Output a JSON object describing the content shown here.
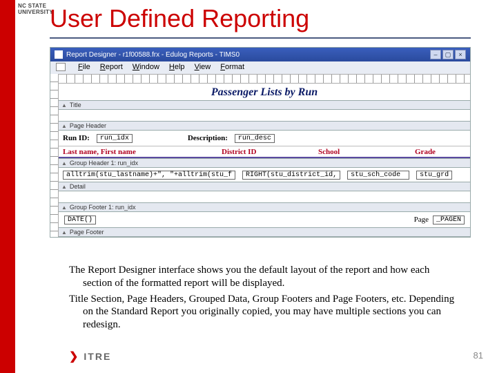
{
  "brand": {
    "line1": "NC STATE",
    "line2": "UNIVERSITY"
  },
  "slide": {
    "title": "User Defined Reporting",
    "page_number": "81"
  },
  "window": {
    "title": "Report Designer - r1f00588.frx - Edulog Reports - TIMS0",
    "menu": [
      "File",
      "Report",
      "Window",
      "Help",
      "View",
      "Format"
    ]
  },
  "report": {
    "title": "Passenger Lists by Run",
    "bands": {
      "title": "Title",
      "page_header": "Page Header",
      "group_header": "Group Header 1: run_idx",
      "detail": "Detail",
      "group_footer": "Group Footer 1: run_idx",
      "page_footer": "Page Footer"
    },
    "page_header_row": {
      "run_id_label": "Run ID:",
      "run_id_field": "run_idx",
      "desc_label": "Description:",
      "desc_field": "run_desc"
    },
    "columns": {
      "name": "Last name, First name",
      "district": "District ID",
      "school": "School",
      "grade": "Grade"
    },
    "detail_fields": {
      "name_expr": "alltrim(stu_lastname)+\", \"+alltrim(stu_f",
      "district_expr": "RIGHT(stu_district_id,",
      "school_expr": "stu_sch_code",
      "grade_expr": "stu_grd"
    },
    "footer": {
      "date_expr": "DATE()",
      "page_label": "Page",
      "pageno_expr": "_PAGEN"
    }
  },
  "body": {
    "p1": "The Report Designer interface shows you the default layout of the report and how each section of the formatted report will be displayed.",
    "p2": "Title Section, Page Headers,  Grouped Data, Group Footers and Page Footers, etc. Depending on the Standard Report you originally copied, you may have multiple sections you can redesign."
  },
  "logo": {
    "text": "ITRE"
  }
}
